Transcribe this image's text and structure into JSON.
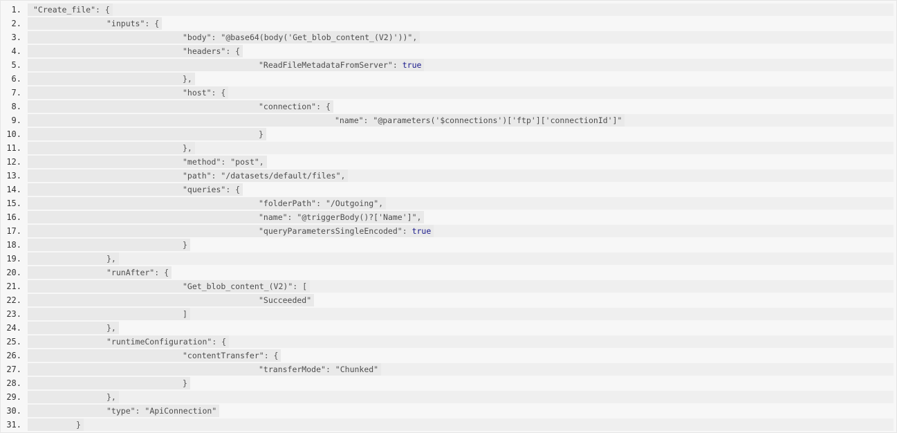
{
  "colors": {
    "panel_background": "#f7f7f7",
    "stripe_background": "#efefef",
    "token_background": "#e9e9e9",
    "string_color": "#4d4d4d",
    "keyword_color": "#1a1a8c",
    "line_number_color": "#333333"
  },
  "lines": [
    {
      "num": "1.",
      "level": 0,
      "tokens": [
        {
          "t": "\"Create_file\"",
          "k": "str"
        },
        {
          "t": ": {",
          "k": "punc"
        }
      ]
    },
    {
      "num": "2.",
      "level": 1,
      "tokens": [
        {
          "t": "\"inputs\"",
          "k": "str"
        },
        {
          "t": ": {",
          "k": "punc"
        }
      ]
    },
    {
      "num": "3.",
      "level": 2,
      "tokens": [
        {
          "t": "\"body\"",
          "k": "str"
        },
        {
          "t": ": ",
          "k": "punc"
        },
        {
          "t": "\"@base64(body('Get_blob_content_(V2)'))\"",
          "k": "str"
        },
        {
          "t": ",",
          "k": "punc"
        }
      ]
    },
    {
      "num": "4.",
      "level": 2,
      "tokens": [
        {
          "t": "\"headers\"",
          "k": "str"
        },
        {
          "t": ": {",
          "k": "punc"
        }
      ]
    },
    {
      "num": "5.",
      "level": 3,
      "tokens": [
        {
          "t": "\"ReadFileMetadataFromServer\"",
          "k": "str"
        },
        {
          "t": ": ",
          "k": "punc"
        },
        {
          "t": "true",
          "k": "kw"
        }
      ]
    },
    {
      "num": "6.",
      "level": 2,
      "tokens": [
        {
          "t": "},",
          "k": "punc"
        }
      ]
    },
    {
      "num": "7.",
      "level": 2,
      "tokens": [
        {
          "t": "\"host\"",
          "k": "str"
        },
        {
          "t": ": {",
          "k": "punc"
        }
      ]
    },
    {
      "num": "8.",
      "level": 3,
      "tokens": [
        {
          "t": "\"connection\"",
          "k": "str"
        },
        {
          "t": ": {",
          "k": "punc"
        }
      ]
    },
    {
      "num": "9.",
      "level": 4,
      "tokens": [
        {
          "t": "\"name\"",
          "k": "str"
        },
        {
          "t": ": ",
          "k": "punc"
        },
        {
          "t": "\"@parameters('$connections')['ftp']['connectionId']\"",
          "k": "str"
        }
      ]
    },
    {
      "num": "10.",
      "level": 3,
      "tokens": [
        {
          "t": "}",
          "k": "punc"
        }
      ]
    },
    {
      "num": "11.",
      "level": 2,
      "tokens": [
        {
          "t": "},",
          "k": "punc"
        }
      ]
    },
    {
      "num": "12.",
      "level": 2,
      "tokens": [
        {
          "t": "\"method\"",
          "k": "str"
        },
        {
          "t": ": ",
          "k": "punc"
        },
        {
          "t": "\"post\"",
          "k": "str"
        },
        {
          "t": ",",
          "k": "punc"
        }
      ]
    },
    {
      "num": "13.",
      "level": 2,
      "tokens": [
        {
          "t": "\"path\"",
          "k": "str"
        },
        {
          "t": ": ",
          "k": "punc"
        },
        {
          "t": "\"/datasets/default/files\"",
          "k": "str"
        },
        {
          "t": ",",
          "k": "punc"
        }
      ]
    },
    {
      "num": "14.",
      "level": 2,
      "tokens": [
        {
          "t": "\"queries\"",
          "k": "str"
        },
        {
          "t": ": {",
          "k": "punc"
        }
      ]
    },
    {
      "num": "15.",
      "level": 3,
      "tokens": [
        {
          "t": "\"folderPath\"",
          "k": "str"
        },
        {
          "t": ": ",
          "k": "punc"
        },
        {
          "t": "\"/Outgoing\"",
          "k": "str"
        },
        {
          "t": ",",
          "k": "punc"
        }
      ]
    },
    {
      "num": "16.",
      "level": 3,
      "tokens": [
        {
          "t": "\"name\"",
          "k": "str"
        },
        {
          "t": ": ",
          "k": "punc"
        },
        {
          "t": "\"@triggerBody()?['Name']\"",
          "k": "str"
        },
        {
          "t": ",",
          "k": "punc"
        }
      ]
    },
    {
      "num": "17.",
      "level": 3,
      "tokens": [
        {
          "t": "\"queryParametersSingleEncoded\"",
          "k": "str"
        },
        {
          "t": ": ",
          "k": "punc"
        },
        {
          "t": "true",
          "k": "kw"
        }
      ]
    },
    {
      "num": "18.",
      "level": 2,
      "tokens": [
        {
          "t": "}",
          "k": "punc"
        }
      ]
    },
    {
      "num": "19.",
      "level": 1,
      "tokens": [
        {
          "t": "},",
          "k": "punc"
        }
      ]
    },
    {
      "num": "20.",
      "level": 1,
      "tokens": [
        {
          "t": "\"runAfter\"",
          "k": "str"
        },
        {
          "t": ": {",
          "k": "punc"
        }
      ]
    },
    {
      "num": "21.",
      "level": 2,
      "tokens": [
        {
          "t": "\"Get_blob_content_(V2)\"",
          "k": "str"
        },
        {
          "t": ": [",
          "k": "punc"
        }
      ]
    },
    {
      "num": "22.",
      "level": 3,
      "tokens": [
        {
          "t": "\"Succeeded\"",
          "k": "str"
        }
      ]
    },
    {
      "num": "23.",
      "level": 2,
      "tokens": [
        {
          "t": "]",
          "k": "punc"
        }
      ]
    },
    {
      "num": "24.",
      "level": 1,
      "tokens": [
        {
          "t": "},",
          "k": "punc"
        }
      ]
    },
    {
      "num": "25.",
      "level": 1,
      "tokens": [
        {
          "t": "\"runtimeConfiguration\"",
          "k": "str"
        },
        {
          "t": ": {",
          "k": "punc"
        }
      ]
    },
    {
      "num": "26.",
      "level": 2,
      "tokens": [
        {
          "t": "\"contentTransfer\"",
          "k": "str"
        },
        {
          "t": ": {",
          "k": "punc"
        }
      ]
    },
    {
      "num": "27.",
      "level": 3,
      "tokens": [
        {
          "t": "\"transferMode\"",
          "k": "str"
        },
        {
          "t": ": ",
          "k": "punc"
        },
        {
          "t": "\"Chunked\"",
          "k": "str"
        }
      ]
    },
    {
      "num": "28.",
      "level": 2,
      "tokens": [
        {
          "t": "}",
          "k": "punc"
        }
      ]
    },
    {
      "num": "29.",
      "level": 1,
      "tokens": [
        {
          "t": "},",
          "k": "punc"
        }
      ]
    },
    {
      "num": "30.",
      "level": 1,
      "tokens": [
        {
          "t": "\"type\"",
          "k": "str"
        },
        {
          "t": ": ",
          "k": "punc"
        },
        {
          "t": "\"ApiConnection\"",
          "k": "str"
        }
      ]
    },
    {
      "num": "31.",
      "level": 0.6,
      "tokens": [
        {
          "t": "}",
          "k": "punc"
        }
      ]
    }
  ]
}
